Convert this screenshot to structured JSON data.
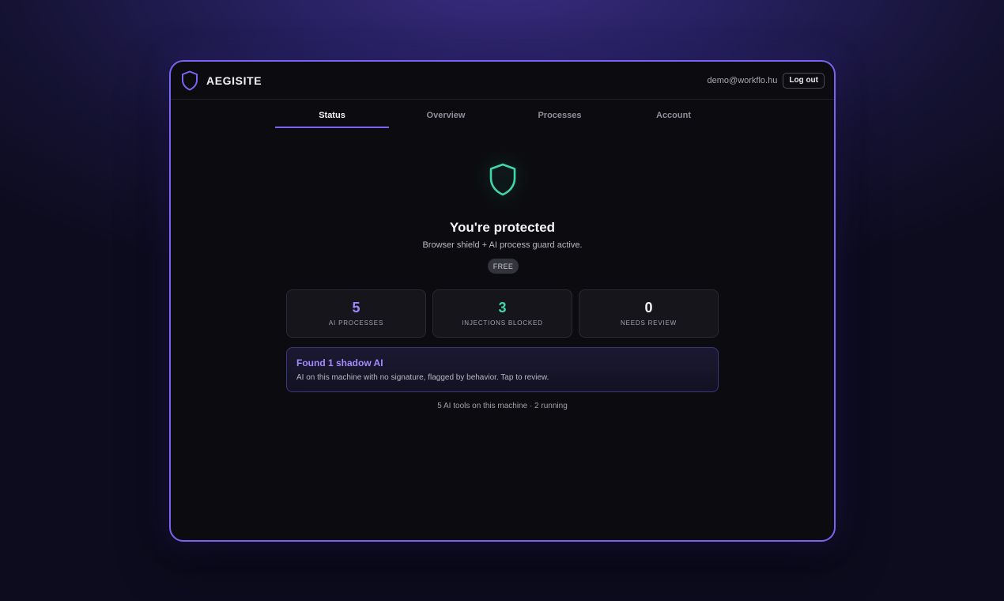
{
  "header": {
    "brand_name": "AEGISITE",
    "logo_icon": "shield-outline-icon",
    "user_email": "demo@workflo.hu",
    "logout_label": "Log out"
  },
  "tabs": [
    {
      "label": "Status",
      "active": true
    },
    {
      "label": "Overview",
      "active": false
    },
    {
      "label": "Processes",
      "active": false
    },
    {
      "label": "Account",
      "active": false
    }
  ],
  "status": {
    "icon": "shield-check-icon",
    "title": "You're protected",
    "subtitle": "Browser shield + AI process guard active.",
    "plan_badge": "FREE"
  },
  "stats": [
    {
      "value": "5",
      "label": "AI PROCESSES",
      "color": "#9d87ff"
    },
    {
      "value": "3",
      "label": "INJECTIONS BLOCKED",
      "color": "#3fd7a8"
    },
    {
      "value": "0",
      "label": "NEEDS REVIEW",
      "color": "#f4f4f7"
    }
  ],
  "alert": {
    "title": "Found 1 shadow AI",
    "description": "AI on this machine with no signature, flagged by behavior. Tap to review."
  },
  "footer": {
    "summary": "5 AI tools on this machine · 2 running"
  },
  "colors": {
    "accent": "#7c63f2",
    "protected_green": "#3fd7a8",
    "window_border": "#7a63f0"
  }
}
